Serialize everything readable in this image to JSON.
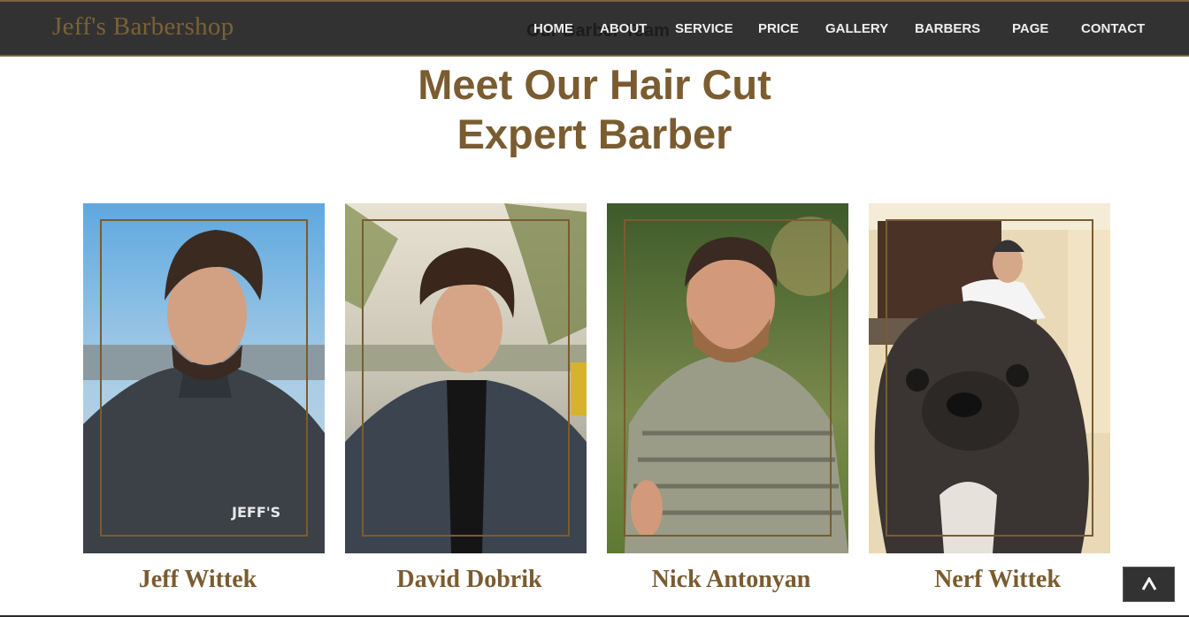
{
  "brand": "Jeff's Barbershop",
  "section_label": "Our Barber Team",
  "nav": [
    {
      "label": "HOME"
    },
    {
      "label": "ABOUT"
    },
    {
      "label": "SERVICE"
    },
    {
      "label": "PRICE"
    },
    {
      "label": "GALLERY"
    },
    {
      "label": "BARBERS"
    },
    {
      "label": "PAGE"
    },
    {
      "label": "CONTACT"
    }
  ],
  "heading": {
    "line1": "Meet Our Hair Cut",
    "line2": "Expert Barber"
  },
  "barbers": [
    {
      "name": "Jeff Wittek"
    },
    {
      "name": "David Dobrik"
    },
    {
      "name": "Nick Antonyan"
    },
    {
      "name": "Nerf Wittek"
    }
  ],
  "colors": {
    "navbar_bg": "#333232",
    "accent_gold": "#7a5c30",
    "nav_text": "#eeeeee"
  },
  "icons": {
    "back_to_top": "caret-up-icon"
  }
}
